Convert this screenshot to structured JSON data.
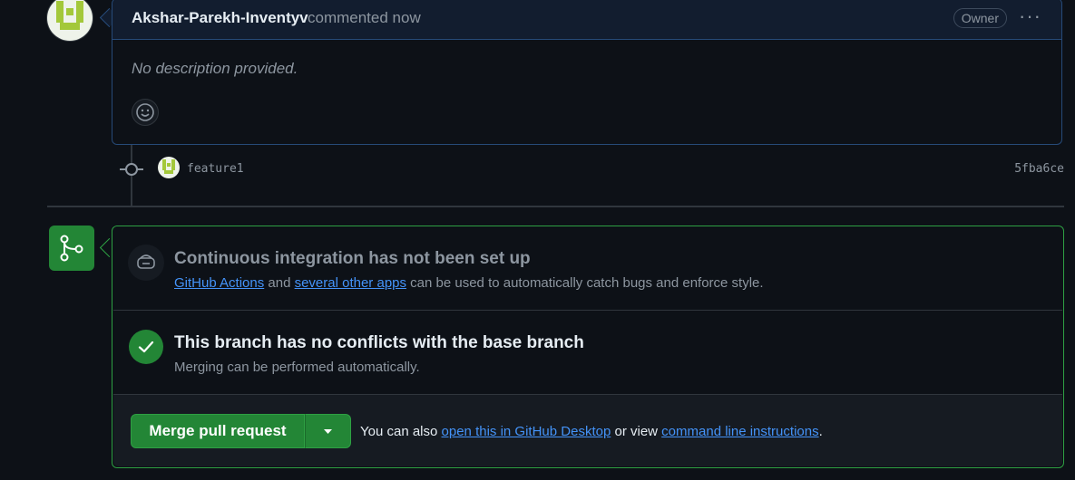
{
  "comment": {
    "author": "Akshar-Parekh-Inventyv",
    "action": "commented now",
    "role_badge": "Owner",
    "menu_glyph": "···",
    "body": "No description provided."
  },
  "commit": {
    "message": "feature1",
    "sha": "5fba6ce"
  },
  "ci": {
    "title": "Continuous integration has not been set up",
    "link1": "GitHub Actions",
    "and": "and",
    "link2": "several other apps",
    "rest": "can be used to automatically catch bugs and enforce style."
  },
  "conflicts": {
    "title": "This branch has no conflicts with the base branch",
    "desc": "Merging can be performed automatically."
  },
  "merge": {
    "button": "Merge pull request",
    "also_prefix": "You can also",
    "desktop_link": "open this in GitHub Desktop",
    "or_view": "or view",
    "cli_link": "command line instructions",
    "period": "."
  },
  "colors": {
    "bg": "#0d1117",
    "success": "#238636",
    "link": "#4493f8",
    "muted": "#8d96a0"
  }
}
